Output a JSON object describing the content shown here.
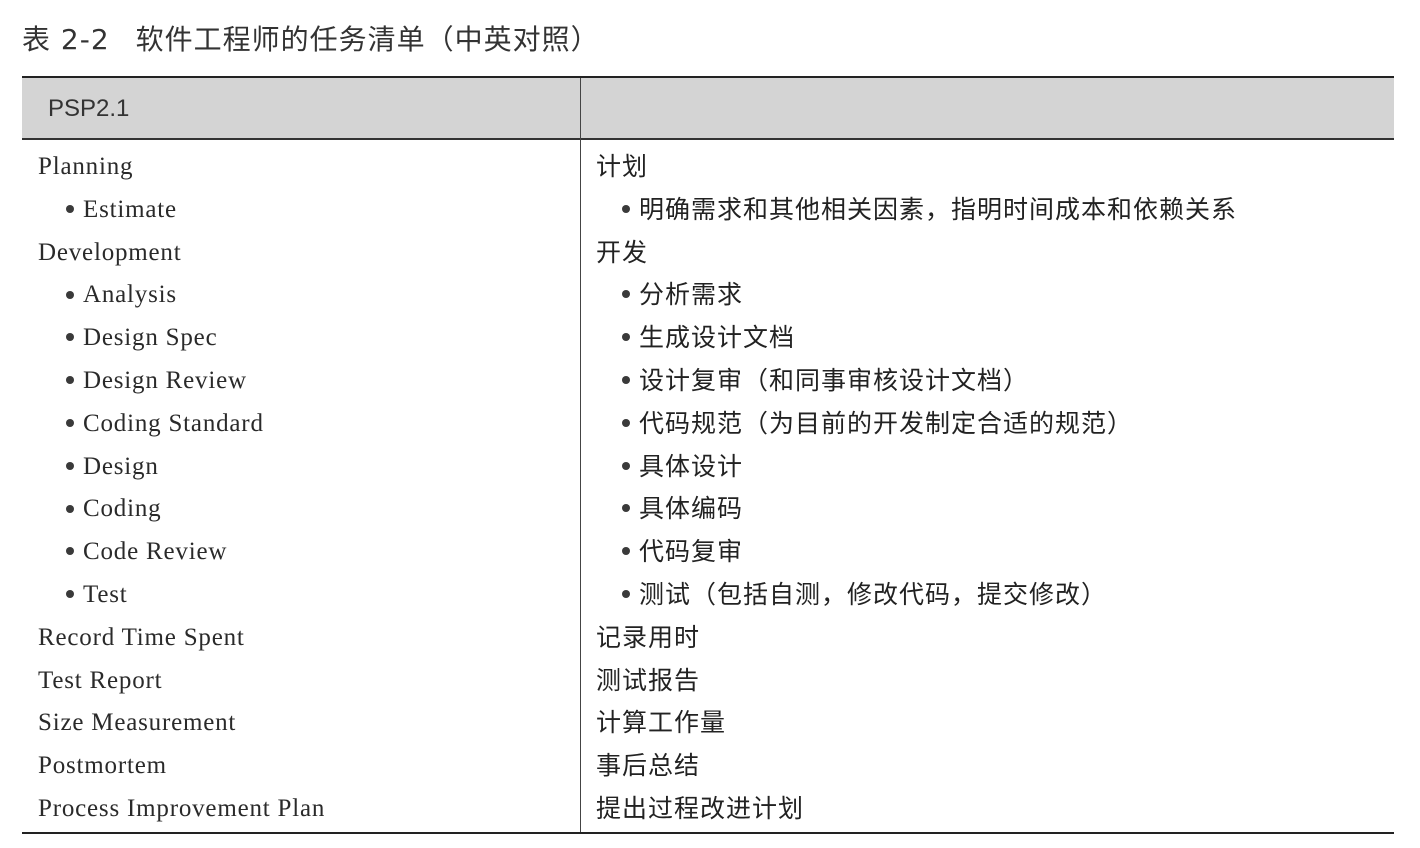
{
  "caption": {
    "number": "表 2-2",
    "title": "软件工程师的任务清单（中英对照）"
  },
  "table": {
    "header": "PSP2.1",
    "rows": [
      {
        "en": "Planning",
        "zh": "计划",
        "sub": false
      },
      {
        "en": "Estimate",
        "zh": "明确需求和其他相关因素，指明时间成本和依赖关系",
        "sub": true
      },
      {
        "en": "Development",
        "zh": "开发",
        "sub": false
      },
      {
        "en": "Analysis",
        "zh": "分析需求",
        "sub": true
      },
      {
        "en": "Design Spec",
        "zh": "生成设计文档",
        "sub": true
      },
      {
        "en": "Design Review",
        "zh": "设计复审（和同事审核设计文档）",
        "sub": true
      },
      {
        "en": "Coding Standard",
        "zh": "代码规范（为目前的开发制定合适的规范）",
        "sub": true
      },
      {
        "en": "Design",
        "zh": "具体设计",
        "sub": true
      },
      {
        "en": "Coding",
        "zh": "具体编码",
        "sub": true
      },
      {
        "en": "Code Review",
        "zh": "代码复审",
        "sub": true
      },
      {
        "en": "Test",
        "zh": "测试（包括自测，修改代码，提交修改）",
        "sub": true
      },
      {
        "en": "Record Time Spent",
        "zh": "记录用时",
        "sub": false
      },
      {
        "en": "Test Report",
        "zh": "测试报告",
        "sub": false
      },
      {
        "en": "Size Measurement",
        "zh": "计算工作量",
        "sub": false
      },
      {
        "en": "Postmortem",
        "zh": "事后总结",
        "sub": false
      },
      {
        "en": "Process Improvement Plan",
        "zh": "提出过程改进计划",
        "sub": false
      }
    ]
  }
}
